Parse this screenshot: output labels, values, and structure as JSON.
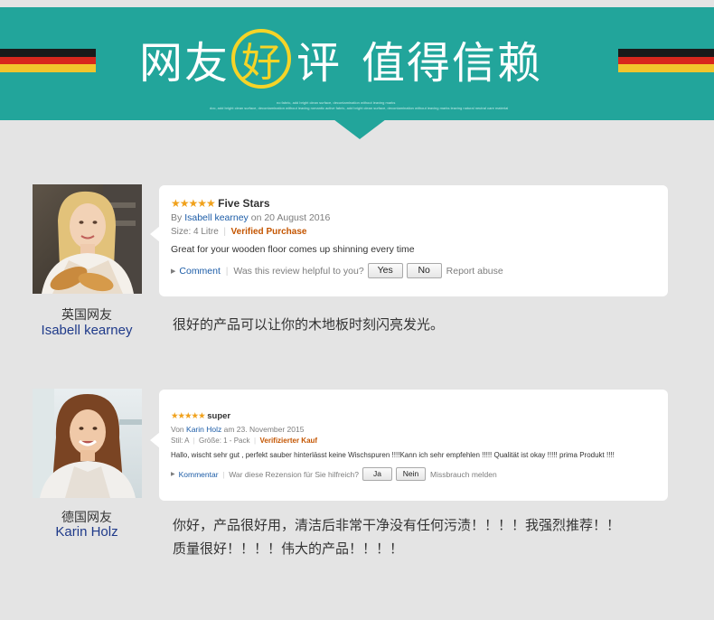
{
  "banner": {
    "title_pre": "网友",
    "title_circle": "好",
    "title_post": "评",
    "title_right": "值得信赖",
    "fine_line1": "no fabric, add bright clean surface, decontamination without leaving marks",
    "fine_line2": "doc, add bright clean surface, decontamination without leaving romantic active fabric, add bright clean surface, decontamination without leaving marks leaving natural neutral care material",
    "accent_color": "#22a59b"
  },
  "reviews": [
    {
      "stars": "★★★★★",
      "headline": "Five Stars",
      "by_prefix": "By",
      "author": "Isabell kearney",
      "date_text": "on 20 August 2016",
      "variant": "Size: 4 Litre",
      "verified": "Verified Purchase",
      "body": "Great for your wooden floor comes up shinning every time",
      "comment_label": "Comment",
      "helpful_question": "Was this review helpful to you?",
      "yes_label": "Yes",
      "no_label": "No",
      "report_label": "Report abuse",
      "reviewer_cn": "英国网友",
      "reviewer_en": "Isabell kearney",
      "comment_cn_1": "很好的产品可以让你的木地板时刻闪亮发光。",
      "comment_cn_2": ""
    },
    {
      "stars": "★★★★★",
      "headline": "super",
      "by_prefix": "Von",
      "author": "Karin Holz",
      "date_text": "am 23. November 2015",
      "variant": "Stil: A",
      "variant2": "Größe: 1 - Pack",
      "verified": "Verifizierter Kauf",
      "body": "Hallo, wischt sehr gut , perfekt sauber hinterlässt keine Wischspuren !!!!Kann ich sehr empfehlen !!!!! Qualität ist okay !!!!! prima Produkt !!!!",
      "comment_label": "Kommentar",
      "helpful_question": "War diese Rezension für Sie hilfreich?",
      "yes_label": "Ja",
      "no_label": "Nein",
      "report_label": "Missbrauch melden",
      "reviewer_cn": "德国网友",
      "reviewer_en": "Karin Holz",
      "comment_cn_1": "你好，产品很好用，清洁后非常干净没有任何污渍！！！！我强烈推荐！！",
      "comment_cn_2": "质量很好！！！！伟大的产品！！！！"
    }
  ]
}
